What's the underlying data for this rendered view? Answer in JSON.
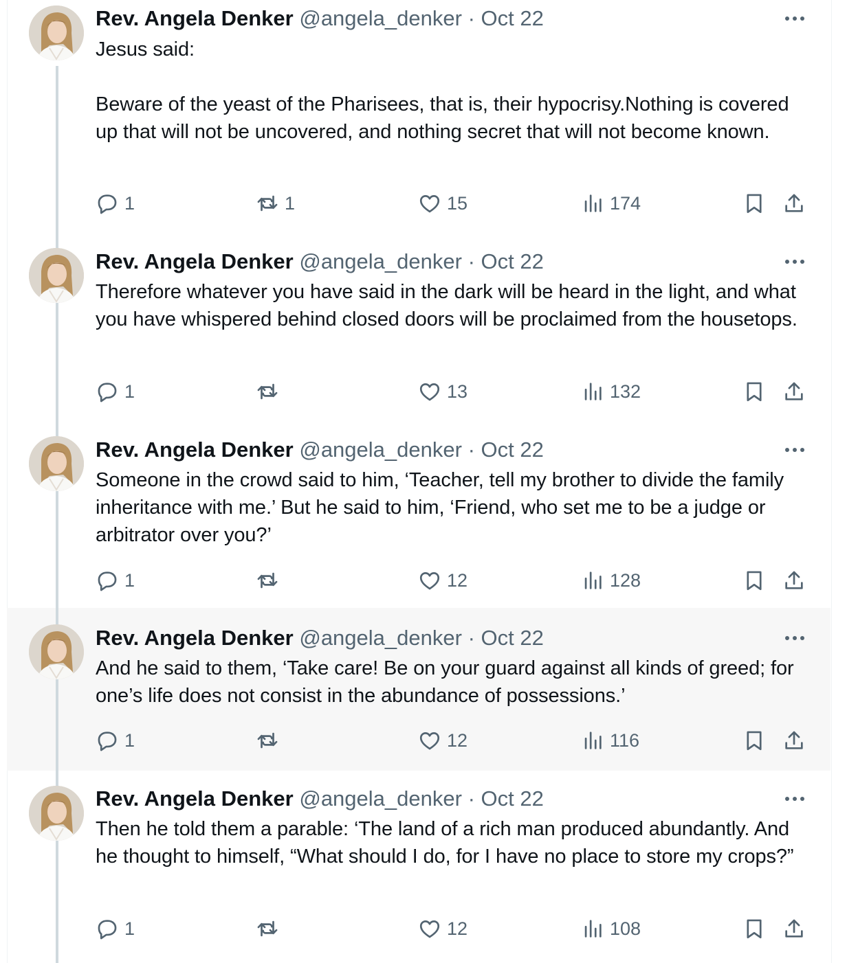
{
  "author": {
    "name": "Rev. Angela Denker",
    "handle": "@angela_denker"
  },
  "tweets": [
    {
      "date": "Oct 22",
      "text": "Jesus said:\n\nBeware of the yeast of the Pharisees, that is, their hypocrisy.Nothing is covered up that will not be uncovered, and nothing secret that will not become known.",
      "replies": "1",
      "reposts": "1",
      "likes": "15",
      "views": "174"
    },
    {
      "date": "Oct 22",
      "text": "Therefore whatever you have said in the dark will be heard in the light, and what you have whispered behind closed doors will be proclaimed from the housetops.",
      "replies": "1",
      "reposts": "",
      "likes": "13",
      "views": "132"
    },
    {
      "date": "Oct 22",
      "text": "Someone in the crowd said to him, ‘Teacher, tell my brother to divide the family inheritance with me.’ But he said to him, ‘Friend, who set me to be a judge or arbitrator over you?’",
      "replies": "1",
      "reposts": "",
      "likes": "12",
      "views": "128"
    },
    {
      "date": "Oct 22",
      "text": "And he said to them, ‘Take care! Be on your guard against all kinds of greed; for one’s life does not consist in the abundance of possessions.’",
      "replies": "1",
      "reposts": "",
      "likes": "12",
      "views": "116"
    },
    {
      "date": "Oct 22",
      "text": "Then he told them a parable: ‘The land of a rich man produced abundantly. And he thought to himself, “What should I do, for I have no place to store my crops?”",
      "replies": "1",
      "reposts": "",
      "likes": "12",
      "views": "108"
    }
  ],
  "icons": {
    "reply": "speech-bubble-icon",
    "repost": "repost-arrows-icon",
    "like": "heart-icon",
    "views": "bar-chart-icon",
    "bookmark": "bookmark-icon",
    "share": "share-upload-icon",
    "more": "ellipsis-icon"
  },
  "colors": {
    "text": "#0f1419",
    "muted": "#536471",
    "thread_line": "#cfd9de",
    "highlight_bg": "#f7f7f7"
  }
}
